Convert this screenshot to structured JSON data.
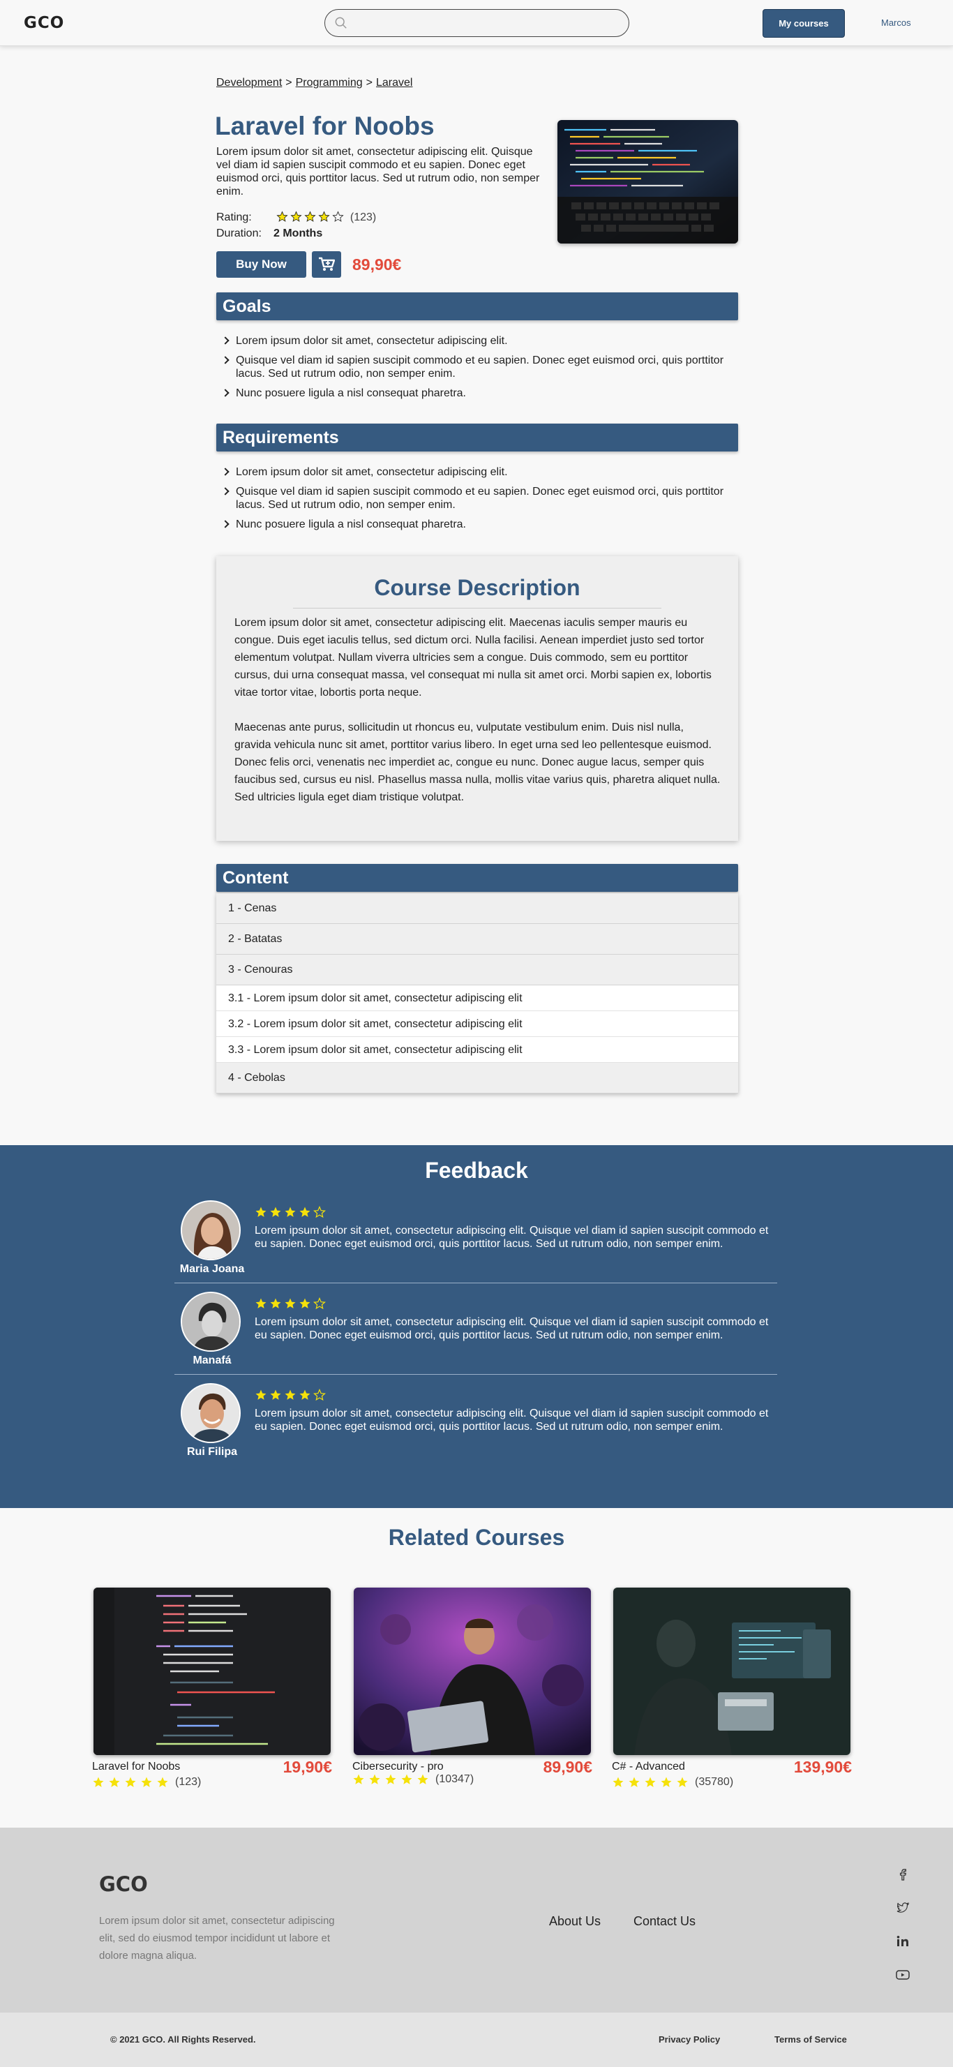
{
  "nav": {
    "logo": "GCO",
    "search_placeholder": "",
    "my_courses": "My courses",
    "user": "Marcos"
  },
  "breadcrumb": [
    "Development",
    "Programming",
    "Laravel"
  ],
  "course": {
    "title": "Laravel for Noobs",
    "intro": "Lorem ipsum dolor sit amet, consectetur adipiscing elit. Quisque vel diam id sapien suscipit commodo et eu sapien. Donec eget euismod orci, quis porttitor lacus. Sed ut rutrum odio, non semper enim.",
    "rating_label": "Rating:",
    "rating_value": 4,
    "rating_count": "(123)",
    "duration_label": "Duration:",
    "duration_value": "2 Months",
    "buy_label": "Buy Now",
    "price": "89,90€"
  },
  "goals": {
    "heading": "Goals",
    "items": [
      "Lorem ipsum dolor sit amet, consectetur adipiscing elit.",
      "Quisque vel diam id sapien suscipit commodo et eu sapien. Donec eget euismod orci, quis porttitor lacus. Sed ut rutrum odio, non semper enim.",
      "Nunc posuere ligula a nisl consequat pharetra."
    ]
  },
  "requirements": {
    "heading": "Requirements",
    "items": [
      "Lorem ipsum dolor sit amet, consectetur adipiscing elit.",
      "Quisque vel diam id sapien suscipit commodo et eu sapien. Donec eget euismod orci, quis porttitor lacus. Sed ut rutrum odio, non semper enim.",
      "Nunc posuere ligula a nisl consequat pharetra."
    ]
  },
  "description": {
    "heading": "Course Description",
    "p1": "Lorem ipsum dolor sit amet, consectetur adipiscing elit. Maecenas iaculis semper mauris eu congue. Duis eget iaculis tellus, sed dictum orci. Nulla facilisi. Aenean imperdiet justo sed tortor elementum volutpat. Nullam viverra ultricies sem a congue. Duis commodo, sem eu porttitor cursus, dui urna consequat massa, vel consequat mi nulla sit amet orci. Morbi sapien ex, lobortis vitae tortor vitae, lobortis porta neque.",
    "p2": "Maecenas ante purus, sollicitudin ut rhoncus eu, vulputate vestibulum enim. Duis nisl nulla, gravida vehicula nunc sit amet, porttitor varius libero. In eget urna sed leo pellentesque euismod. Donec felis orci, venenatis nec imperdiet ac, congue eu nunc. Donec augue lacus, semper quis faucibus sed, cursus eu nisl. Phasellus massa nulla, mollis vitae varius quis, pharetra aliquet nulla. Sed ultricies ligula eget diam tristique volutpat."
  },
  "content": {
    "heading": "Content",
    "ch1": "1 - Cenas",
    "ch2": "2 - Batatas",
    "ch3": "3 - Cenouras",
    "sub1": "3.1  - Lorem ipsum dolor sit amet, consectetur adipiscing elit",
    "sub2": "3.2 - Lorem ipsum dolor sit amet, consectetur adipiscing elit",
    "sub3": "3.3 - Lorem ipsum dolor sit amet, consectetur adipiscing elit",
    "ch4": "4 - Cebolas"
  },
  "feedback": {
    "heading": "Feedback",
    "items": [
      {
        "name": "Maria Joana",
        "rating": 4,
        "text": "Lorem ipsum dolor sit amet, consectetur adipiscing elit. Quisque vel diam id sapien suscipit commodo et eu sapien. Donec eget euismod orci, quis porttitor lacus. Sed ut rutrum odio, non semper enim."
      },
      {
        "name": "Manafá",
        "rating": 4,
        "text": "Lorem ipsum dolor sit amet, consectetur adipiscing elit. Quisque vel diam id sapien suscipit commodo et eu sapien. Donec eget euismod orci, quis porttitor lacus. Sed ut rutrum odio, non semper enim."
      },
      {
        "name": "Rui Filipa",
        "rating": 4,
        "text": "Lorem ipsum dolor sit amet, consectetur adipiscing elit. Quisque vel diam id sapien suscipit commodo et eu sapien. Donec eget euismod orci, quis porttitor lacus. Sed ut rutrum odio, non semper enim."
      }
    ]
  },
  "related": {
    "heading": "Related Courses",
    "cards": [
      {
        "name": "Laravel for Noobs",
        "price": "19,90€",
        "rating": 5,
        "count": "(123)"
      },
      {
        "name": "Cibersecurity - pro",
        "price": "89,90€",
        "rating": 5,
        "count": "(10347)"
      },
      {
        "name": "C# - Advanced",
        "price": "139,90€",
        "rating": 5,
        "count": "(35780)"
      }
    ]
  },
  "footer": {
    "logo": "GCO",
    "desc": "Lorem ipsum dolor sit amet, consectetur adipiscing elit, sed do eiusmod tempor incididunt ut labore et dolore magna aliqua.",
    "about": "About Us",
    "contact": "Contact Us",
    "social_icons": [
      "facebook-icon",
      "twitter-icon",
      "linkedin-icon",
      "youtube-icon"
    ],
    "copyright": "© 2021 GCO.  All Rights Reserved.",
    "privacy": "Privacy Policy",
    "terms": "Terms of Service"
  },
  "colors": {
    "primary": "#365a80",
    "price": "#e24a3b",
    "star": "#f5e10a"
  }
}
